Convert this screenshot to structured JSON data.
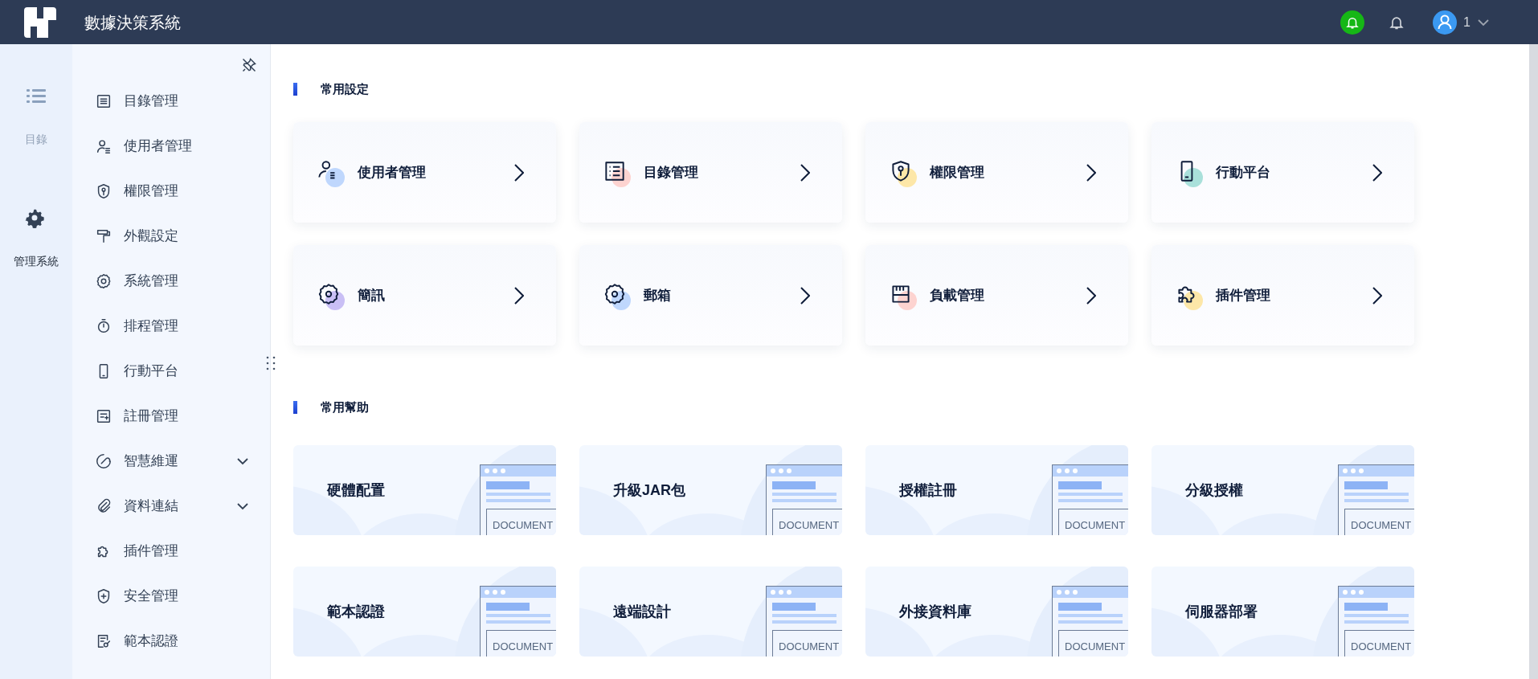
{
  "header": {
    "title": "數據決策系統",
    "user_name": "1"
  },
  "rail": [
    {
      "label": "目錄",
      "selected": false
    },
    {
      "label": "管理系統",
      "selected": true
    }
  ],
  "menu": [
    {
      "label": "目錄管理",
      "kind": "item"
    },
    {
      "label": "使用者管理",
      "kind": "item"
    },
    {
      "label": "權限管理",
      "kind": "item"
    },
    {
      "label": "外觀設定",
      "kind": "item"
    },
    {
      "label": "系統管理",
      "kind": "item"
    },
    {
      "label": "排程管理",
      "kind": "item"
    },
    {
      "label": "行動平台",
      "kind": "item"
    },
    {
      "label": "註冊管理",
      "kind": "item"
    },
    {
      "label": "智慧維運",
      "kind": "group",
      "expanded": false
    },
    {
      "label": "資料連結",
      "kind": "group",
      "expanded": false
    },
    {
      "label": "插件管理",
      "kind": "item"
    },
    {
      "label": "安全管理",
      "kind": "item"
    },
    {
      "label": "範本認證",
      "kind": "item"
    }
  ],
  "settings": {
    "title": "常用設定",
    "cards": [
      {
        "label": "使用者管理",
        "color": "#bfd7fd"
      },
      {
        "label": "目錄管理",
        "color": "#fdd3d0"
      },
      {
        "label": "權限管理",
        "color": "#fde7a8"
      },
      {
        "label": "行動平台",
        "color": "#a9e0da"
      },
      {
        "label": "簡訊",
        "color": "#c9bff5"
      },
      {
        "label": "郵箱",
        "color": "#bfd7fd"
      },
      {
        "label": "負載管理",
        "color": "#fdd3d0"
      },
      {
        "label": "插件管理",
        "color": "#fde7a8"
      }
    ]
  },
  "help": {
    "title": "常用幫助",
    "cards": [
      {
        "label": "硬體配置",
        "illustration_text": "DOCUMENT"
      },
      {
        "label": "升級JAR包",
        "illustration_text": "DOCUMENT"
      },
      {
        "label": "授權註冊",
        "illustration_text": "DOCUMENT"
      },
      {
        "label": "分級授權",
        "illustration_text": "DOCUMENT"
      },
      {
        "label": "範本認證",
        "illustration_text": "DOCUMENT"
      },
      {
        "label": "遠端設計",
        "illustration_text": "DOCUMENT"
      },
      {
        "label": "外接資料庫",
        "illustration_text": "DOCUMENT"
      },
      {
        "label": "伺服器部署",
        "illustration_text": "DOCUMENT"
      }
    ]
  }
}
